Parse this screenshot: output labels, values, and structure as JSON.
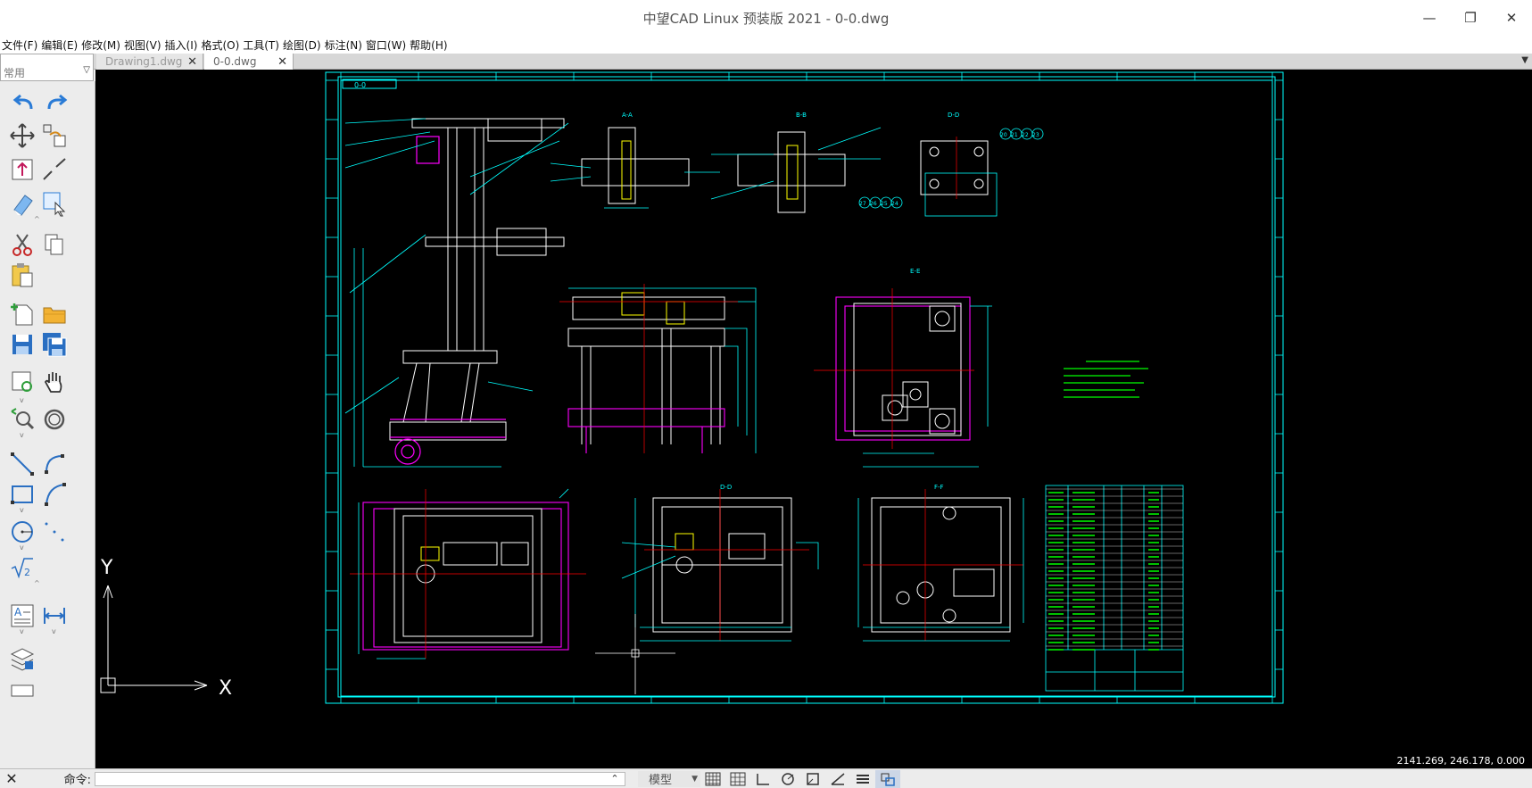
{
  "window": {
    "title": "中望CAD Linux 预装版 2021 - 0-0.dwg",
    "minimize": "—",
    "restore": "❐",
    "close": "✕"
  },
  "menu": [
    "文件(F)",
    "编辑(E)",
    "修改(M)",
    "视图(V)",
    "插入(I)",
    "格式(O)",
    "工具(T)",
    "绘图(D)",
    "标注(N)",
    "窗口(W)",
    "帮助(H)"
  ],
  "toolbar_combo": {
    "value": "常用"
  },
  "tabs": [
    {
      "label": "Drawing1.dwg",
      "close": "✕",
      "active": false
    },
    {
      "label": "0-0.dwg",
      "close": "✕",
      "active": true
    }
  ],
  "tools": [
    "undo-icon",
    "redo-icon",
    "move-icon",
    "copy-icon",
    "stretch-icon",
    "break-icon",
    "erase-icon",
    "select-icon",
    "cut-icon",
    "copy-clip-icon",
    "paste-icon",
    "new-icon",
    "open-icon",
    "save-icon",
    "save-as-icon",
    "zoom-window-icon",
    "pan-icon",
    "zoom-icon",
    "orbit-icon",
    "line-icon",
    "arc-icon",
    "rect-icon",
    "arc2-icon",
    "circle-icon",
    "point-icon",
    "sqrt-icon",
    "text-icon",
    "dim-icon",
    "layer-icon"
  ],
  "drawing": {
    "title_block_label": "0-0",
    "view_labels": [
      "A-A",
      "B-B",
      "D-D",
      "E-E",
      "D-D",
      "F-F"
    ],
    "callouts": [
      "20",
      "21",
      "22",
      "23",
      "27",
      "26",
      "25",
      "24"
    ],
    "ucs": {
      "y_label": "Y",
      "x_label": "X"
    },
    "colors": {
      "border": "#00ffff",
      "geometry": "#ffffff",
      "magenta": "#ff00ff",
      "green": "#00ff00",
      "red": "#ff0000",
      "yellow": "#ffff00"
    }
  },
  "coordinates": "2141.269, 246.178, 0.000",
  "command": {
    "label": "命令:",
    "value": "",
    "mode": "模型"
  }
}
